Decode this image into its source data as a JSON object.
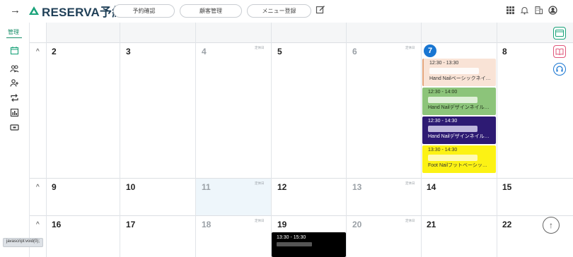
{
  "header": {
    "back_icon": "arrow-right-icon",
    "brand": "RESERVA予約",
    "brand_color": "#1aa37a",
    "nav": [
      "予約確認",
      "顧客管理",
      "メニュー登録"
    ],
    "right_icons": [
      "grid-icon",
      "bell-icon",
      "building-icon",
      "user-circle-icon"
    ]
  },
  "sidebar": {
    "label": "管理",
    "icons": [
      "calendar-icon",
      "users-icon",
      "user-add-icon",
      "repeat-icon",
      "chart-icon",
      "ticket-icon"
    ]
  },
  "calendar": {
    "closed_label": "定休日",
    "today": "7",
    "rows": [
      {
        "days": [
          "2",
          "3",
          "4",
          "5",
          "6",
          "7",
          "8"
        ]
      },
      {
        "days": [
          "9",
          "10",
          "11",
          "12",
          "13",
          "14",
          "15"
        ]
      },
      {
        "days": [
          "16",
          "17",
          "18",
          "19",
          "20",
          "21",
          "22"
        ]
      }
    ],
    "events": [
      {
        "time": "12:30 - 13:30",
        "name": "Hand Nailベーシックネイ…",
        "color": "#f9e3d6"
      },
      {
        "time": "12:30 - 14:00",
        "name": "Hand Nailデザインネイル…",
        "color": "#8cc47a"
      },
      {
        "time": "12:30 - 14:30",
        "name": "Hand Nailデザインネイル…",
        "color": "#2d1a73"
      },
      {
        "time": "13:30 - 14:30",
        "name": "Foot Nailフットベーシッ…",
        "color": "#fcf214"
      }
    ],
    "event_19": {
      "time": "13:30 - 15:30",
      "color": "#000000"
    }
  },
  "floating_icons": [
    "window-icon",
    "book-icon",
    "headset-icon"
  ],
  "status_bar": {
    "text": "javascript:void(0);"
  }
}
